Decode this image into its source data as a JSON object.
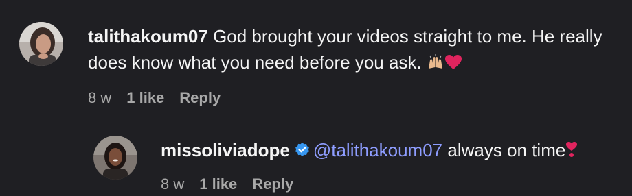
{
  "comments": [
    {
      "username": "talithakoum07",
      "text": "God brought your videos straight to me. He really does know what you need before you ask.",
      "emojis": [
        "raising-hands-icon",
        "red-heart-icon"
      ],
      "time": "8 w",
      "likes": "1 like",
      "reply_label": "Reply"
    },
    {
      "username": "missoliviadope",
      "verified": true,
      "mention": "@talithakoum07",
      "text": "always on time",
      "emojis": [
        "exclamation-heart-icon"
      ],
      "time": "8 w",
      "likes": "1 like",
      "reply_label": "Reply"
    }
  ],
  "colors": {
    "background": "#1f1f23",
    "text": "#f5f5f5",
    "muted": "#a8a8a8",
    "mention": "#8e9dff",
    "verified": "#3797f0",
    "heart": "#e0245e"
  }
}
